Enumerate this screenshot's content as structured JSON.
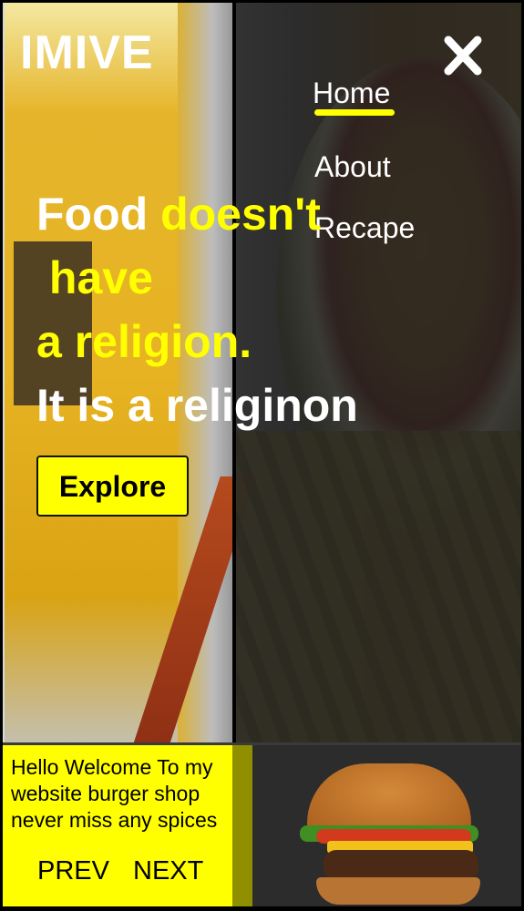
{
  "brand": "IMIVE",
  "nav": {
    "items": [
      {
        "label": "Home",
        "active": true
      },
      {
        "label": "About",
        "active": false
      },
      {
        "label": "Recape",
        "active": false
      }
    ],
    "close_icon": "close-icon"
  },
  "hero": {
    "line1_white": "Food ",
    "line1_yellow": "doesn't",
    "line2_yellow": "have",
    "line3_white": "a ",
    "line3_yellow": "religion.",
    "line4_white": "It is a religinon",
    "explore_label": "Explore"
  },
  "info": {
    "text_line1": "Hello Welcome To my",
    "text_line2": "website burger shop",
    "text_line3": "never miss any spices",
    "prev_label": "PREV",
    "next_label": "NEXT"
  },
  "colors": {
    "accent": "#ffff00",
    "overlay": "#1e1e1e",
    "text": "#ffffff"
  }
}
